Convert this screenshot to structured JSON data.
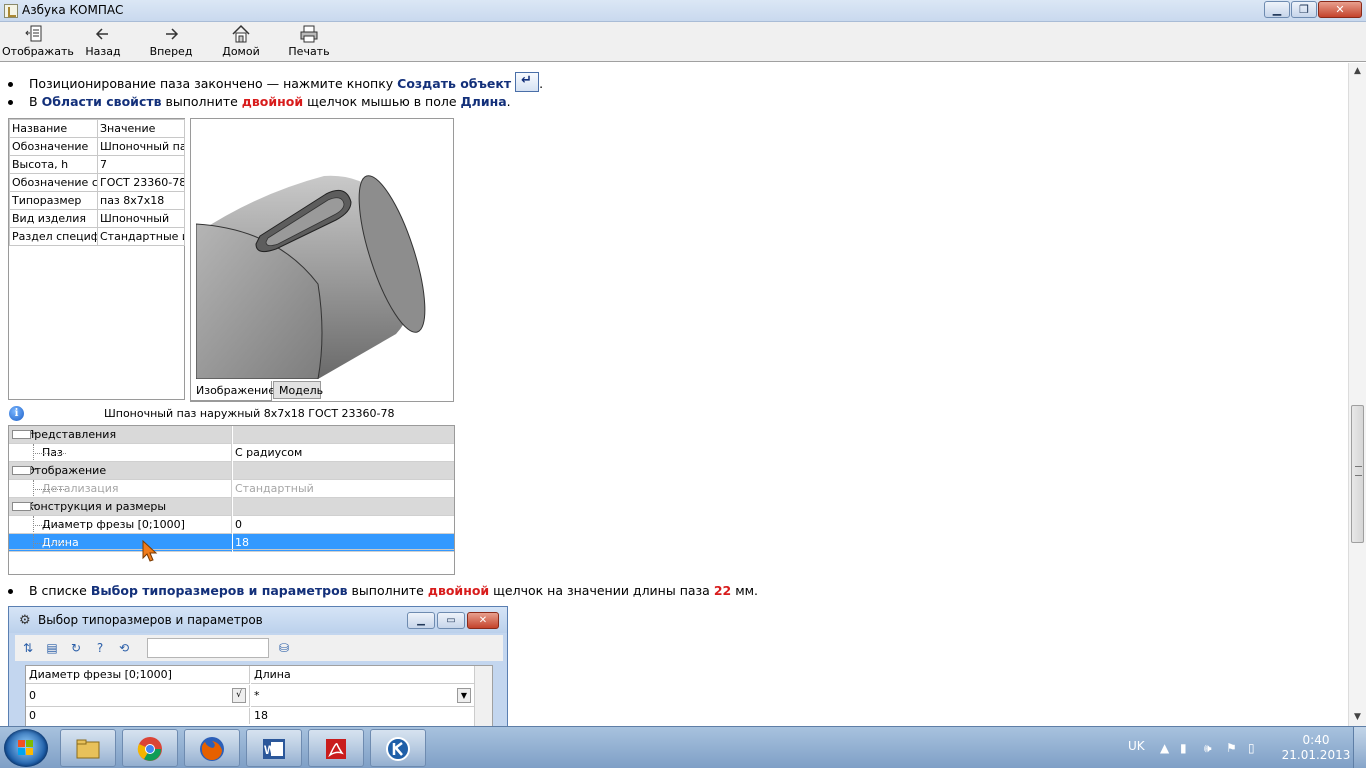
{
  "window": {
    "title": "Азбука КОМПАС"
  },
  "toolbar": {
    "buttons": [
      {
        "label": "Отображать",
        "icon": "show-panel-icon"
      },
      {
        "label": "Назад",
        "icon": "arrow-left-icon"
      },
      {
        "label": "Вперед",
        "icon": "arrow-right-icon"
      },
      {
        "label": "Домой",
        "icon": "home-icon"
      },
      {
        "label": "Печать",
        "icon": "printer-icon"
      }
    ]
  },
  "content": {
    "step1": {
      "text_before": "Позиционирование паза закончено — нажмите кнопку ",
      "highlight": "Создать объект",
      "text_after": "."
    },
    "step2": {
      "t1": "В ",
      "h1": "Области свойств",
      "t2": " выполните ",
      "h2": "двойной",
      "t3": " щелчок мышью в поле ",
      "h3": "Длина",
      "t4": "."
    },
    "properties": {
      "headers": [
        "Название",
        "Значение"
      ],
      "rows": [
        [
          "Обозначение",
          "Шпоночный паз"
        ],
        [
          "Высота, h",
          "7"
        ],
        [
          "Обозначение ст",
          "ГОСТ 23360-78"
        ],
        [
          "Типоразмер",
          "паз 8x7x18"
        ],
        [
          "Вид изделия",
          "Шпоночный"
        ],
        [
          "Раздел специфи",
          "Стандартные из"
        ]
      ]
    },
    "image_tabs": [
      "Изображение",
      "Модель"
    ],
    "info_caption": "Шпоночный паз наружный 8x7x18 ГОСТ 23360-78",
    "tree": {
      "rows": [
        {
          "name": "Представления",
          "value": ""
        },
        {
          "name": "Паз",
          "value": "С радиусом"
        },
        {
          "name": "Отображение",
          "value": ""
        },
        {
          "name": "Детализация",
          "value": "Стандартный"
        },
        {
          "name": "Конструкция и размеры",
          "value": ""
        },
        {
          "name": "Диаметр фрезы [0;1000]",
          "value": "0"
        },
        {
          "name": "Длина",
          "value": "18"
        }
      ]
    },
    "step3": {
      "t1": "В списке ",
      "h1": "Выбор типоразмеров и параметров",
      "t2": " выполните ",
      "h2": "двойной",
      "t3": " щелчок на значении длины паза ",
      "h3": "22",
      "t4": " мм."
    },
    "subwindow": {
      "title": "Выбор типоразмеров и параметров",
      "columns": [
        "Диаметр фрезы [0;1000]",
        "Длина"
      ],
      "filter_row": [
        "0",
        "*"
      ],
      "data_row": [
        "0",
        "18"
      ]
    }
  },
  "taskbar": {
    "language": "UK",
    "time": "0:40",
    "date": "21.01.2013"
  },
  "colors": {
    "highlight_blue": "#13307a",
    "highlight_red": "#d81c1c",
    "selection": "#3399ff"
  }
}
